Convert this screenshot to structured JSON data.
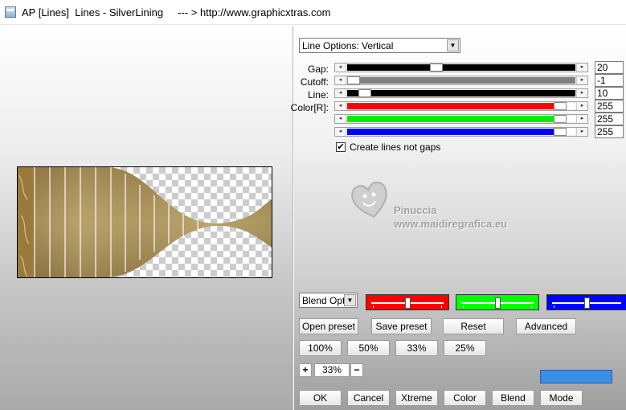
{
  "window": {
    "title": "AP [Lines]  Lines - SilverLining     --- > http://www.graphicxtras.com"
  },
  "line_options": {
    "selected": "Line Options: Vertical"
  },
  "sliders": [
    {
      "label": "Gap:",
      "value": "20",
      "fill": "#000000",
      "track_bg": "#000000",
      "level": 0.38
    },
    {
      "label": "Cutoff:",
      "value": "-1",
      "fill": "#808080",
      "track_bg": "#808080",
      "level": 0.0
    },
    {
      "label": "Line:",
      "value": "10",
      "fill": "#000000",
      "track_bg": "#000000",
      "level": 0.05
    },
    {
      "label": "Color[R]:",
      "value": "255",
      "fill": "#ff0000",
      "track_bg": "#ffffff",
      "level": 0.95
    },
    {
      "label": "",
      "value": "255",
      "fill": "#00ee00",
      "track_bg": "#ffffff",
      "level": 0.95
    },
    {
      "label": "",
      "value": "255",
      "fill": "#0000ff",
      "track_bg": "#ffffff",
      "level": 0.95
    }
  ],
  "checkbox": {
    "label": "Create lines not gaps",
    "checked": true,
    "mark": "✔"
  },
  "watermark": {
    "name": "Pinuccia",
    "url": "www.maidiregrafica.eu"
  },
  "blend": {
    "select_value": "Blend Optio",
    "boxes": [
      {
        "color": "#ff0000",
        "knob_level": 0.5
      },
      {
        "color": "#00ff00",
        "knob_level": 0.5
      },
      {
        "color": "#0000ff",
        "knob_level": 0.5
      }
    ]
  },
  "buttons": {
    "open_preset": "Open preset",
    "save_preset": "Save preset",
    "reset": "Reset",
    "advanced": "Advanced",
    "z100": "100%",
    "z50": "50%",
    "z33": "33%",
    "z25": "25%",
    "plus": "+",
    "minus": "−",
    "ok": "OK",
    "cancel": "Cancel",
    "xtreme": "Xtreme",
    "color": "Color",
    "blend": "Blend",
    "mode": "Mode"
  },
  "zoom": {
    "value": "33%"
  },
  "accent_swatch": "#3d8ee6"
}
